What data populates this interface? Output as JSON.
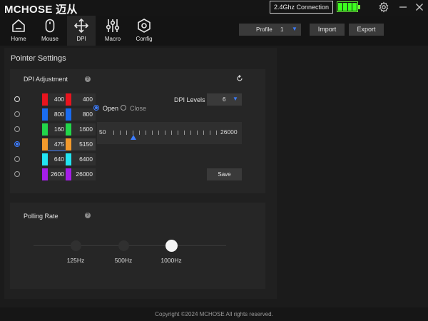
{
  "app": {
    "brand": "MCHOSE 迈从",
    "connection": "2.4Ghz Connection",
    "battery_level": 1.0
  },
  "nav": {
    "items": [
      {
        "label": "Home",
        "icon": "home-icon"
      },
      {
        "label": "Mouse",
        "icon": "mouse-icon"
      },
      {
        "label": "DPI",
        "icon": "move-arrows-icon",
        "active": true
      },
      {
        "label": "Macro",
        "icon": "sliders-icon"
      },
      {
        "label": "Config",
        "icon": "hex-nut-icon"
      }
    ],
    "profile_label": "Profile",
    "profile_value": "1",
    "import_label": "Import",
    "export_label": "Export"
  },
  "pointer": {
    "title": "Pointer Settings",
    "dpi_title": "DPI Adjustment",
    "help_glyph": "?",
    "rows": [
      {
        "color": "#e8141e",
        "left": "400",
        "right": "400",
        "selected": false
      },
      {
        "color": "#1a6cf0",
        "left": "800",
        "right": "800",
        "selected": false
      },
      {
        "color": "#22d64a",
        "left": "160",
        "right": "1600",
        "selected": false
      },
      {
        "color": "#f39a2c",
        "left": "475",
        "right": "5150",
        "selected": true
      },
      {
        "color": "#22e4f2",
        "left": "640",
        "right": "6400",
        "selected": false
      },
      {
        "color": "#a51ee8",
        "left": "2600",
        "right": "26000",
        "selected": false
      }
    ],
    "open_label": "Open",
    "close_label": "Close",
    "levels_label": "DPI Levels",
    "levels_value": "6",
    "slider_min": "50",
    "slider_max": "26000",
    "slider_value": 5150,
    "save_label": "Save"
  },
  "polling": {
    "title": "Polling Rate",
    "options": [
      {
        "label": "125Hz",
        "selected": false
      },
      {
        "label": "500Hz",
        "selected": false
      },
      {
        "label": "1000Hz",
        "selected": true
      }
    ]
  },
  "footer": {
    "copyright": "Copyright ©2024 MCHOSE All rights reserved."
  }
}
